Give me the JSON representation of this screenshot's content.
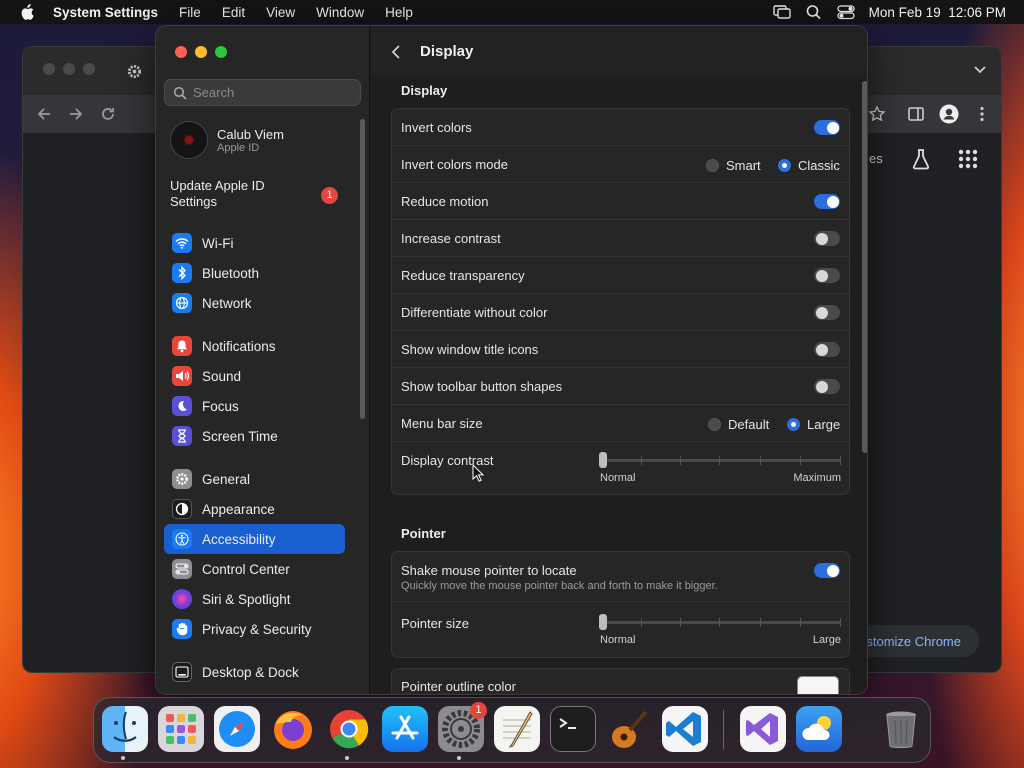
{
  "menubar": {
    "app_name": "System Settings",
    "items": [
      "File",
      "Edit",
      "View",
      "Window",
      "Help"
    ],
    "datetime": "Mon Feb 19  12:06 PM",
    "icons": [
      "apple-icon",
      "screen-mirroring-icon",
      "spotlight-search-icon",
      "control-center-icon"
    ]
  },
  "chrome": {
    "customize_label": "ustomize Chrome",
    "partial_text": "es"
  },
  "sidebar": {
    "search_placeholder": "Search",
    "account": {
      "name": "Calub Viem",
      "subtitle": "Apple ID"
    },
    "update_label": "Update Apple ID Settings",
    "update_badge": "1",
    "items": [
      {
        "label": "Wi-Fi",
        "icon": "wifi-icon",
        "color": "#1a7cf5"
      },
      {
        "label": "Bluetooth",
        "icon": "bluetooth-icon",
        "color": "#1a7cf5"
      },
      {
        "label": "Network",
        "icon": "globe-icon",
        "color": "#1a7cf5"
      },
      {
        "label": "Notifications",
        "icon": "bell-icon",
        "color": "#e8453c"
      },
      {
        "label": "Sound",
        "icon": "speaker-icon",
        "color": "#e8453c"
      },
      {
        "label": "Focus",
        "icon": "moon-icon",
        "color": "#5b4fd6"
      },
      {
        "label": "Screen Time",
        "icon": "hourglass-icon",
        "color": "#5b4fd6"
      },
      {
        "label": "General",
        "icon": "gear-icon",
        "color": "#8e8e93"
      },
      {
        "label": "Appearance",
        "icon": "appearance-icon",
        "color": "#1c1c1e"
      },
      {
        "label": "Accessibility",
        "icon": "accessibility-icon",
        "color": "#1a7cf5"
      },
      {
        "label": "Control Center",
        "icon": "control-center-icon",
        "color": "#8e8e93"
      },
      {
        "label": "Siri & Spotlight",
        "icon": "siri-icon",
        "color": "#7a3ad8"
      },
      {
        "label": "Privacy & Security",
        "icon": "hand-icon",
        "color": "#1a7cf5"
      },
      {
        "label": "Desktop & Dock",
        "icon": "dock-icon",
        "color": "#1c1c1e"
      }
    ],
    "selected": "Accessibility"
  },
  "content": {
    "title": "Display",
    "display_section": {
      "title": "Display",
      "rows": [
        {
          "label": "Invert colors",
          "control": "toggle",
          "on": true
        },
        {
          "label": "Invert colors mode",
          "control": "radio",
          "options": [
            "Smart",
            "Classic"
          ],
          "selected": "Classic"
        },
        {
          "label": "Reduce motion",
          "control": "toggle",
          "on": true
        },
        {
          "label": "Increase contrast",
          "control": "toggle",
          "on": false
        },
        {
          "label": "Reduce transparency",
          "control": "toggle",
          "on": false
        },
        {
          "label": "Differentiate without color",
          "control": "toggle",
          "on": false
        },
        {
          "label": "Show window title icons",
          "control": "toggle",
          "on": false
        },
        {
          "label": "Show toolbar button shapes",
          "control": "toggle",
          "on": false
        },
        {
          "label": "Menu bar size",
          "control": "radio",
          "options": [
            "Default",
            "Large"
          ],
          "selected": "Large"
        },
        {
          "label": "Display contrast",
          "control": "slider",
          "min_label": "Normal",
          "max_label": "Maximum",
          "value": 0
        }
      ]
    },
    "pointer_section": {
      "title": "Pointer",
      "shake": {
        "label": "Shake mouse pointer to locate",
        "sub": "Quickly move the mouse pointer back and forth to make it bigger.",
        "on": true
      },
      "size": {
        "label": "Pointer size",
        "min_label": "Normal",
        "max_label": "Large",
        "value": 0
      },
      "outline": {
        "label": "Pointer outline color",
        "color": "#f6f6f6"
      }
    }
  },
  "dock": {
    "apps": [
      "Finder",
      "Launchpad",
      "Safari",
      "Firefox",
      "Google Chrome",
      "App Store",
      "System Settings",
      "TextEdit",
      "Terminal",
      "GarageBand",
      "Visual Studio Code",
      "Visual Studio",
      "Weather",
      "Trash"
    ],
    "settings_badge": "1"
  }
}
